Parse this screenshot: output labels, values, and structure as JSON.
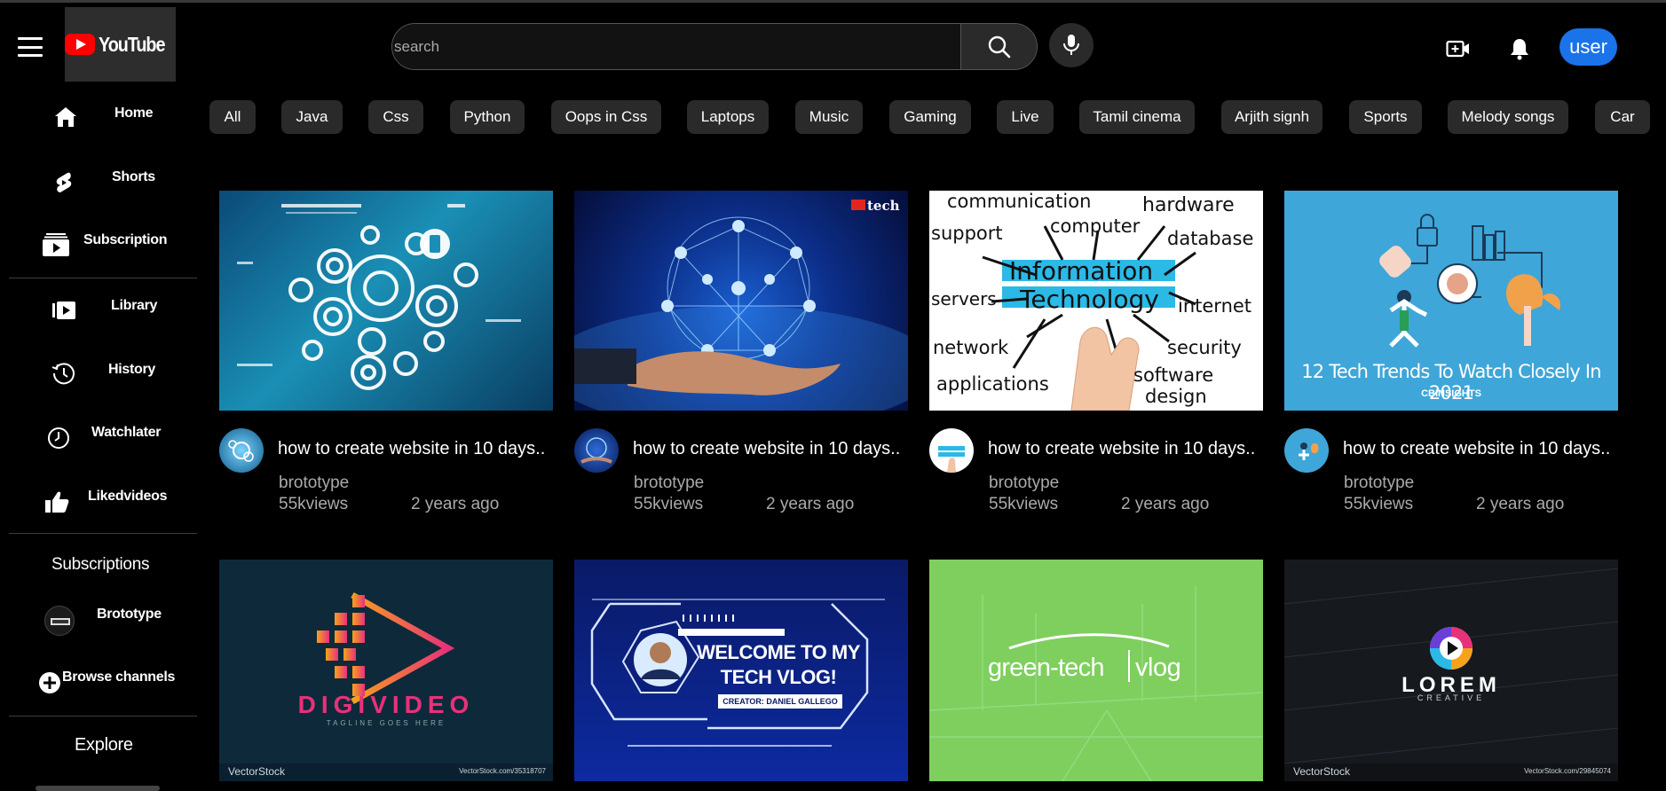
{
  "header": {
    "logo_text": "YouTube",
    "search_placeholder": "search",
    "user_label": "user"
  },
  "chips": [
    "All",
    "Java",
    "Css",
    "Python",
    "Oops in Css",
    "Laptops",
    "Music",
    "Gaming",
    "Live",
    "Tamil cinema",
    "Arjith signh",
    "Sports",
    "Melody songs",
    "Car"
  ],
  "sidebar": {
    "items": [
      {
        "label": "Home",
        "icon": "home-icon"
      },
      {
        "label": "Shorts",
        "icon": "shorts-icon"
      },
      {
        "label": "Subscription",
        "icon": "subscription-icon"
      },
      {
        "label": "Library",
        "icon": "library-icon"
      },
      {
        "label": "History",
        "icon": "history-icon"
      },
      {
        "label": "Watchlater",
        "icon": "clock-icon"
      },
      {
        "label": "Likedvideos",
        "icon": "thumbs-up-icon"
      }
    ],
    "subscriptions_heading": "Subscriptions",
    "channel": {
      "label": "Brototype"
    },
    "browse_label": "Browse channels",
    "explore_heading": "Explore"
  },
  "videos": [
    {
      "title": "how to create website in 10 days..",
      "channel": "brototype",
      "views": "55kviews",
      "age": "2 years ago"
    },
    {
      "title": "how to create website in 10 days..",
      "channel": "brototype",
      "views": "55kviews",
      "age": "2 years ago",
      "badge": "tech"
    },
    {
      "title": "how to create website in 10 days..",
      "channel": "brototype",
      "views": "55kviews",
      "age": "2 years ago",
      "thumb_words": [
        "communication",
        "hardware",
        "computer",
        "support",
        "database",
        "Information",
        "Technology",
        "servers",
        "internet",
        "network",
        "security",
        "applications",
        "software",
        "design"
      ]
    },
    {
      "title": "how to create website in 10 days..",
      "channel": "brototype",
      "views": "55kviews",
      "age": "2 years ago",
      "thumb_text": "12 Tech Trends To Watch Closely In 2021",
      "thumb_brand": "CBINSIGHTS"
    }
  ],
  "thumbs_row2": [
    {
      "brand": "DIGIVIDEO",
      "tagline": "TAGLINE GOES HERE",
      "stock": "VectorStock",
      "stock_id": "VectorStock.com/35318707"
    },
    {
      "headline1": "WELCOME TO MY",
      "headline2": "TECH VLOG!",
      "creator": "CREATOR: DANIEL GALLEGO"
    },
    {
      "brand": "green-tech",
      "brand2": "vlog"
    },
    {
      "brand": "LOREM",
      "sub": "CREATIVE",
      "stock": "VectorStock",
      "stock_id": "VectorStock.com/29845074"
    }
  ]
}
